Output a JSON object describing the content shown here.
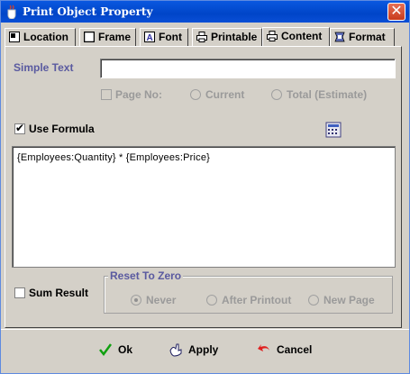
{
  "window": {
    "title": "Print Object Property"
  },
  "tabs": [
    {
      "label": "Location",
      "icon": "location-tab-icon"
    },
    {
      "label": "Frame",
      "icon": "frame-tab-icon"
    },
    {
      "label": "Font",
      "icon": "font-tab-icon"
    },
    {
      "label": "Printable",
      "icon": "printer-tab-icon"
    },
    {
      "label": "Content",
      "icon": "printer-tab-icon",
      "active": true
    },
    {
      "label": "Format",
      "icon": "format-tab-icon"
    }
  ],
  "content": {
    "simple_text_label": "Simple Text",
    "simple_text_value": "",
    "page_no_label": "Page No:",
    "current_label": "Current",
    "total_label": "Total (Estimate)",
    "use_formula_label": "Use Formula",
    "use_formula_checked": true,
    "formula": "{Employees:Quantity} * {Employees:Price}",
    "sum_result_label": "Sum Result",
    "sum_result_checked": false,
    "reset_group_label": "Reset To Zero",
    "reset_options": [
      "Never",
      "After Printout",
      "New Page"
    ],
    "reset_selected": "Never"
  },
  "buttons": {
    "ok": "Ok",
    "apply": "Apply",
    "cancel": "Cancel"
  },
  "colors": {
    "titlebar": "#0045c8",
    "label_blue": "#5a5aa0",
    "dialog_bg": "#d4d0c8"
  }
}
